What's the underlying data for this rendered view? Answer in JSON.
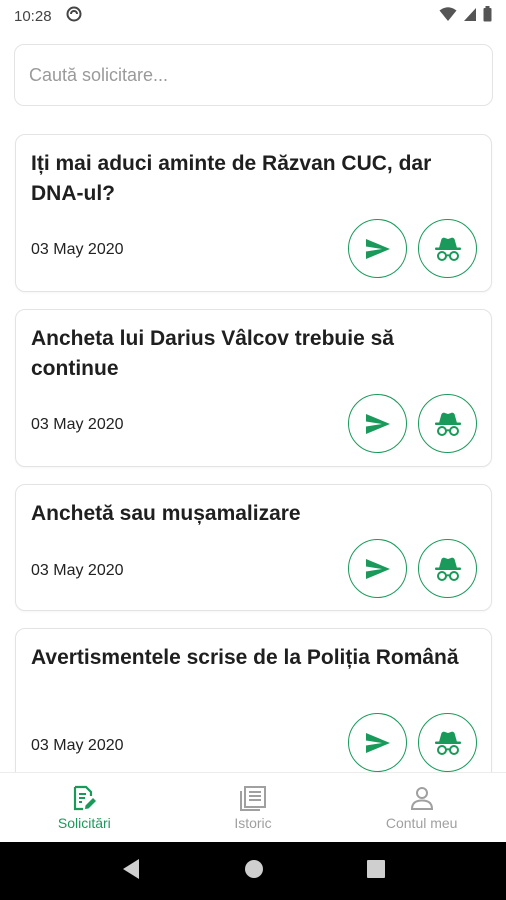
{
  "status_bar": {
    "time": "10:28"
  },
  "search": {
    "placeholder": "Caută solicitare..."
  },
  "requests": [
    {
      "title": "Iți mai aduci aminte de Răzvan CUC, dar DNA-ul?",
      "date": "03 May 2020"
    },
    {
      "title": "Ancheta lui Darius Vâlcov trebuie să continue",
      "date": "03 May 2020"
    },
    {
      "title": "Anchetă sau mușamalizare",
      "date": "03 May 2020"
    },
    {
      "title": "Avertismentele scrise de la Poliția Română",
      "date": "03 May 2020"
    }
  ],
  "bottom_nav": {
    "items": [
      {
        "label": "Solicitări",
        "icon": "edit-document-icon",
        "active": true
      },
      {
        "label": "Istoric",
        "icon": "history-list-icon",
        "active": false
      },
      {
        "label": "Contul meu",
        "icon": "person-icon",
        "active": false
      }
    ]
  },
  "colors": {
    "accent": "#1a9a5a",
    "inactive": "#a0a0a0",
    "card_border": "#e3e3e3"
  }
}
